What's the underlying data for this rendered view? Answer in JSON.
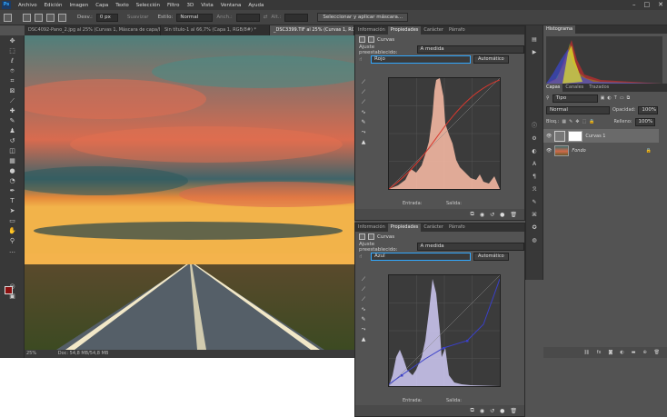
{
  "menubar": {
    "logo": "Ps",
    "items": [
      "Archivo",
      "Edición",
      "Imagen",
      "Capa",
      "Texto",
      "Selección",
      "Filtro",
      "3D",
      "Vista",
      "Ventana",
      "Ayuda"
    ],
    "window_controls": [
      "–",
      "□",
      "✕"
    ]
  },
  "options": {
    "blur_label": "Desv.:",
    "blur_value": "0 px",
    "smooth_label": "Suavizar",
    "style_label": "Estilo:",
    "style_value": "Normal",
    "width_label": "Anch.:",
    "height_label": "Alt.:",
    "select_mask_button": "Seleccionar y aplicar máscara..."
  },
  "doc_tabs": [
    "DSC4092-Pano_2.jpg al 25% (Curvas 1, Máscara de capa/8) *",
    "Sin título-1 al 66,7% (Capa 1, RGB/8#) *",
    "_DSC3399.TIF al 25% (Curvas 1, RGB/16*) *"
  ],
  "status": {
    "zoom": "25%",
    "doc": "Doc: 54,8 MB/54,8 MB"
  },
  "props_tabs": [
    "Información",
    "Propiedades",
    "Carácter",
    "Párrafo"
  ],
  "props1": {
    "title": "Curvas",
    "preset_label": "Ajuste preestablecido:",
    "preset_value": "A medida",
    "channel": "Rojo",
    "auto": "Automático",
    "input_label": "Entrada:",
    "output_label": "Salida:"
  },
  "props2": {
    "title": "Curvas",
    "preset_label": "Ajuste preestablecido:",
    "preset_value": "A medida",
    "channel": "Azul",
    "auto": "Automático",
    "input_label": "Entrada:",
    "output_label": "Salida:"
  },
  "histogram": {
    "tab": "Histograma"
  },
  "layers": {
    "tabs": [
      "Capas",
      "Canales",
      "Trazados"
    ],
    "filter": "Tipo",
    "blend": "Normal",
    "opacity_label": "Opacidad:",
    "opacity": "100%",
    "lock_label": "Bloq.:",
    "fill_label": "Relleno:",
    "fill": "100%",
    "items": [
      {
        "name": "Curvas 1"
      },
      {
        "name": "Fondo"
      }
    ]
  },
  "colors": {
    "accent": "#31a8ff",
    "red_curve": "#d8382e",
    "blue_curve": "#3a40c8"
  }
}
